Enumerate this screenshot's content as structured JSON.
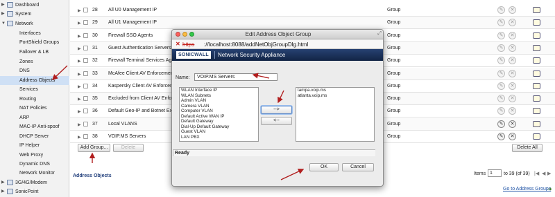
{
  "nav": {
    "items": [
      {
        "label": "Dashboard",
        "icon": "dashboard-icon",
        "level": 0
      },
      {
        "label": "System",
        "icon": "system-icon",
        "level": 0
      },
      {
        "label": "Network",
        "icon": "network-icon",
        "level": 0,
        "expanded": true
      },
      {
        "label": "Interfaces",
        "level": 1
      },
      {
        "label": "PortShield Groups",
        "level": 1
      },
      {
        "label": "Failover & LB",
        "level": 1
      },
      {
        "label": "Zones",
        "level": 1
      },
      {
        "label": "DNS",
        "level": 1
      },
      {
        "label": "Address Objects",
        "level": 1,
        "selected": true
      },
      {
        "label": "Services",
        "level": 1
      },
      {
        "label": "Routing",
        "level": 1
      },
      {
        "label": "NAT Policies",
        "level": 1
      },
      {
        "label": "ARP",
        "level": 1
      },
      {
        "label": "MAC-IP Anti-spoof",
        "level": 1
      },
      {
        "label": "DHCP Server",
        "level": 1
      },
      {
        "label": "IP Helper",
        "level": 1
      },
      {
        "label": "Web Proxy",
        "level": 1
      },
      {
        "label": "Dynamic DNS",
        "level": 1
      },
      {
        "label": "Network Monitor",
        "level": 1
      },
      {
        "label": "3G/4G/Modem",
        "icon": "modem-icon",
        "level": 0
      },
      {
        "label": "SonicPoint",
        "icon": "sonicpoint-icon",
        "level": 0
      }
    ]
  },
  "table": {
    "rows": [
      {
        "num": "28",
        "name": "All U0 Management IP",
        "type": "Group",
        "editable": false
      },
      {
        "num": "29",
        "name": "All U1 Management IP",
        "type": "Group",
        "editable": false
      },
      {
        "num": "30",
        "name": "Firewall SSO Agents",
        "type": "Group",
        "editable": false
      },
      {
        "num": "31",
        "name": "Guest Authentication Servers",
        "type": "Group",
        "editable": false
      },
      {
        "num": "32",
        "name": "Firewall Terminal Services Agents",
        "type": "Group",
        "editable": false
      },
      {
        "num": "33",
        "name": "McAfee Client AV Enforcement List",
        "type": "Group",
        "editable": false
      },
      {
        "num": "34",
        "name": "Kaspersky Client AV Enforcement List",
        "type": "Group",
        "editable": false
      },
      {
        "num": "35",
        "name": "Excluded from Client AV Enforcement",
        "type": "Group",
        "editable": false
      },
      {
        "num": "36",
        "name": "Default Geo-IP and Botnet Exclusion",
        "type": "Group",
        "editable": false
      },
      {
        "num": "37",
        "name": "Local VLANS",
        "type": "Group",
        "editable": true
      },
      {
        "num": "38",
        "name": "VOIP.MS Servers",
        "type": "Group",
        "editable": true
      }
    ],
    "add_group_label": "Add Group...",
    "delete_label": "Delete",
    "delete_all_label": "Delete All"
  },
  "footer": {
    "section_title": "Address Objects",
    "items_label": "Items",
    "items_from": "1",
    "items_range": "to 39 (of 39)",
    "goto_link": "Go to Address Groups"
  },
  "dialog": {
    "title": "Edit Address Object Group",
    "url_scheme": "https",
    "url_rest": "://localhost:8088/addNetObjGroupDlg.html",
    "brand": "SONICWALL",
    "app_name": "Network Security Appliance",
    "name_label": "Name:",
    "name_value": "VOIP.MS Servers",
    "available": [
      "WLAN Interface IP",
      "WLAN Subnets",
      "Admin VLAN",
      "Camera VLAN",
      "Computer VLAN",
      "Default Active WAN IP",
      "Default Gateway",
      "Dial-Up Default Gateway",
      "Guest VLAN",
      "LAN PBX"
    ],
    "members": [
      "tampa.voip.ms",
      "atlanta.voip.ms"
    ],
    "add_label": "-->",
    "remove_label": "<--",
    "status": "Ready",
    "ok_label": "OK",
    "cancel_label": "Cancel"
  },
  "colors": {
    "banner": "#1d3563",
    "accent_link": "#1a4fa3",
    "annotation_arrow": "#b11e1e"
  }
}
